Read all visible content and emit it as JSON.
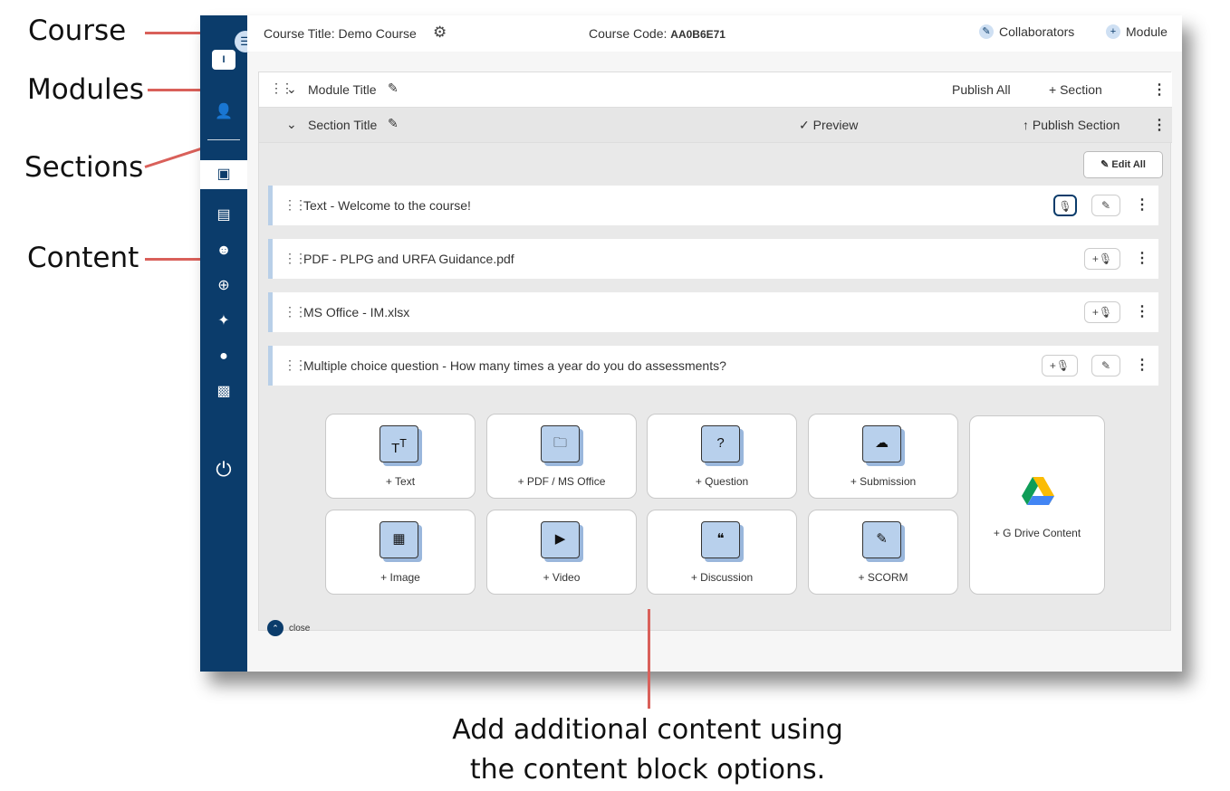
{
  "callouts": {
    "course": "Course",
    "modules": "Modules",
    "sections": "Sections",
    "content": "Content",
    "caption_line1": "Add additional content using",
    "caption_line2": "the content block options."
  },
  "sidebar": {
    "avatar_initial": "I",
    "items": [
      {
        "icon": "user-icon"
      },
      {
        "icon": "course-book-icon",
        "active": true
      },
      {
        "icon": "library-icon"
      },
      {
        "icon": "users-group-icon"
      },
      {
        "icon": "add-circle-icon"
      },
      {
        "icon": "sparkle-icon"
      },
      {
        "icon": "chat-bubble-icon"
      },
      {
        "icon": "podium-icon"
      },
      {
        "icon": "power-icon"
      }
    ]
  },
  "topbar": {
    "course_title": "Course Title: Demo Course",
    "course_code_label": "Course Code:",
    "course_code": "AA0B6E71",
    "collaborators": "Collaborators",
    "module": "Module"
  },
  "module": {
    "title": "Module Title",
    "publish_all": "Publish All",
    "add_section": "+ Section"
  },
  "section": {
    "title": "Section Title",
    "preview": "Preview",
    "publish_section": "Publish Section",
    "edit_all": "Edit All"
  },
  "content_items": [
    {
      "label": "Text - Welcome to the course!"
    },
    {
      "label": "PDF - PLPG and URFA Guidance.pdf"
    },
    {
      "label": "MS Office - IM.xlsx"
    },
    {
      "label": "Multiple choice question - How many times a year do you do assessments?"
    }
  ],
  "blocks": [
    {
      "label": "+ Text",
      "icon": "text-icon"
    },
    {
      "label": "+ PDF / MS Office",
      "icon": "folder-icon"
    },
    {
      "label": "+ Question",
      "icon": "question-icon"
    },
    {
      "label": "+ Submission",
      "icon": "cloud-upload-icon"
    },
    {
      "label": "+ Image",
      "icon": "image-icon"
    },
    {
      "label": "+ Video",
      "icon": "video-icon"
    },
    {
      "label": "+ Discussion",
      "icon": "discussion-icon"
    },
    {
      "label": "+ SCORM",
      "icon": "scorm-icon"
    },
    {
      "label": "+ G Drive Content",
      "icon": "google-drive-icon"
    }
  ],
  "close_label": "close",
  "colors": {
    "sidebar": "#0b3c6b",
    "callout_line": "#d9605a",
    "accent_light": "#b8d0ec"
  }
}
